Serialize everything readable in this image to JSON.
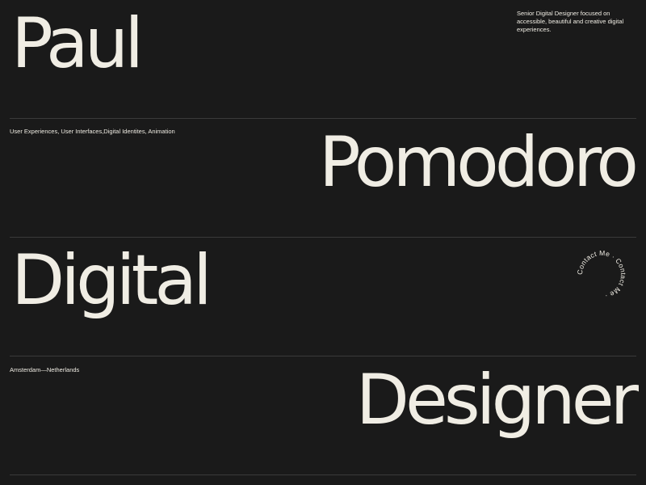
{
  "hero": {
    "line1": "Paul",
    "line2": "Pomodoro",
    "line3": "Digital",
    "line4": "Designer"
  },
  "tagline": "Senior Digital Designer focused on accessible, beautiful and creative digital experiences.",
  "services": "User Experiences, User Interfaces,Digital Identites, Animation",
  "location": "Amsterdam—Netherlands",
  "contact": {
    "badge_text": "Contact Me · Contact Me · "
  },
  "colors": {
    "background": "#1a1a1a",
    "text": "#f0ede4",
    "divider": "#3a3a3a"
  }
}
